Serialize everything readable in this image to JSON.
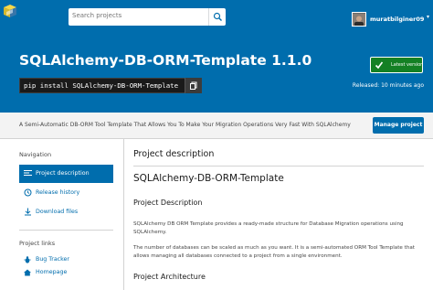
{
  "header": {
    "search_placeholder": "Search projects",
    "username": "muratbilginer09"
  },
  "project": {
    "title": "SQLAlchemy-DB-ORM-Template 1.1.0",
    "pip_command": "pip install SQLAlchemy-DB-ORM-Template",
    "latest_label": "Latest version",
    "released": "Released: 10 minutes ago",
    "summary": "A Semi-Automatic DB-ORM Tool Template That Allows You To Make Your Migration Operations Very Fast With SQLAlchemy",
    "manage_label": "Manage project"
  },
  "sidebar": {
    "nav_heading": "Navigation",
    "nav_items": [
      {
        "label": "Project description",
        "active": true
      },
      {
        "label": "Release history",
        "active": false
      },
      {
        "label": "Download files",
        "active": false
      }
    ],
    "links_heading": "Project links",
    "links": [
      {
        "label": "Bug Tracker"
      },
      {
        "label": "Homepage"
      }
    ]
  },
  "main": {
    "section_heading": "Project description",
    "readme_title": "SQLAlchemy-DB-ORM-Template",
    "subheading_1": "Project Description",
    "paragraph_1": "SQLAlchemy DB ORM Template provides a ready-made structure for Database Migration operations using SQLAlchemy.",
    "paragraph_2": "The number of databases can be scaled as much as you want. It is a semi-automated ORM Tool Template that allows managing all databases connected to a project from a single environment.",
    "subheading_2": "Project Architecture"
  },
  "colors": {
    "brand_blue": "#006dad",
    "success_green": "#148024",
    "pip_box": "#1a1a1a"
  }
}
